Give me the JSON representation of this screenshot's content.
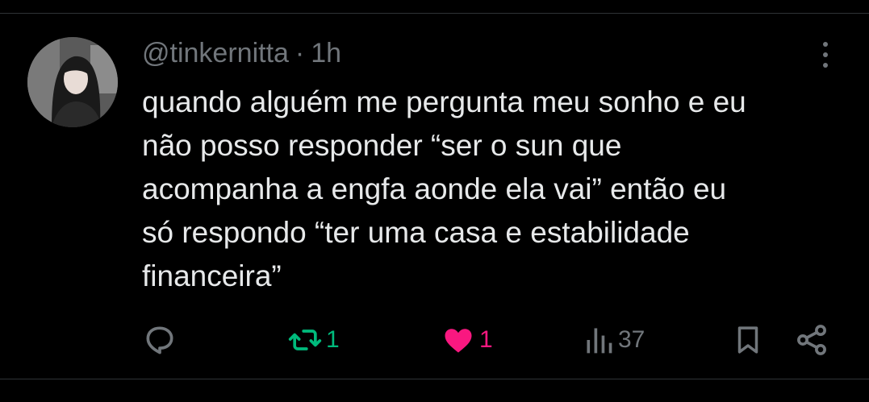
{
  "tweet": {
    "handle": "@tinkernitta",
    "separator": "·",
    "time": "1h",
    "text": "quando alguém me pergunta meu sonho e eu\nnão posso responder “ser o sun que\nacompanha a engfa aonde ela vai” então eu\nsó respondo “ter uma casa e estabilidade\nfinanceira”"
  },
  "actions": {
    "reply_icon": "reply-icon",
    "retweet_icon": "retweet-icon",
    "retweet_count": "1",
    "like_icon": "heart-icon",
    "like_count": "1",
    "views_icon": "views-icon",
    "views_count": "37",
    "bookmark_icon": "bookmark-icon",
    "share_icon": "share-icon"
  },
  "colors": {
    "background": "#000000",
    "text": "#e7e9ea",
    "muted": "#71767b",
    "retweet_active": "#00ba7c",
    "like_active": "#f91880",
    "divider": "#2f3336"
  }
}
